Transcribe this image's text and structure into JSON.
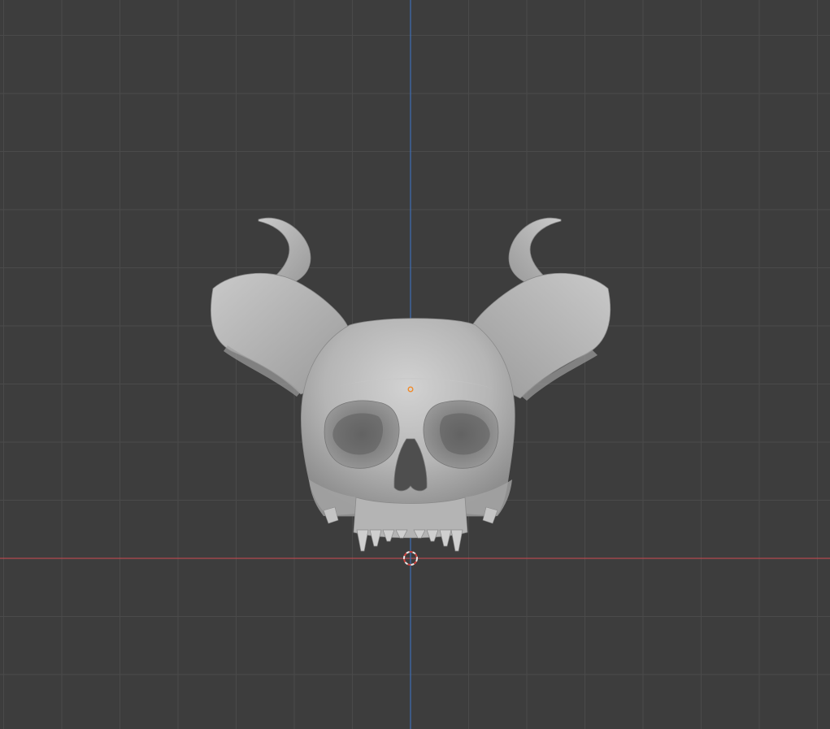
{
  "viewport": {
    "view": "front-orthographic",
    "background_color": "#3d3d3d",
    "grid_color": "#4a4a4a",
    "x_axis_color": "#b34a4f",
    "z_axis_color": "#3f6fb5",
    "mesh_color": "#b9b9b9",
    "object_origin_color": "#f08a2a",
    "cursor_colors": [
      "#e8e8e8",
      "#d0443f"
    ]
  },
  "scene": {
    "object": "demon-skull-mesh",
    "has_horns": true,
    "has_teeth": true
  }
}
